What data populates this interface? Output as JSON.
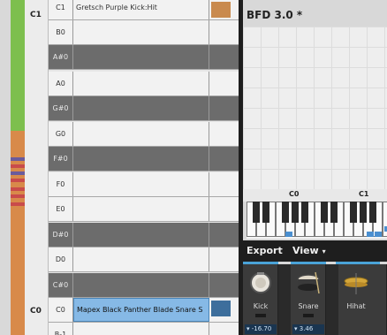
{
  "octave_labels": {
    "c1": "C1",
    "c0": "C0"
  },
  "rows": [
    {
      "note": "C1",
      "type": "white",
      "instrument": "Gretsch Purple Kick:Hit",
      "swatch": "#c98a4e",
      "selected": false
    },
    {
      "note": "B0",
      "type": "white",
      "instrument": "",
      "swatch": null,
      "selected": false
    },
    {
      "note": "A#0",
      "type": "black",
      "instrument": "",
      "swatch": null,
      "selected": false
    },
    {
      "note": "A0",
      "type": "white",
      "instrument": "",
      "swatch": null,
      "selected": false
    },
    {
      "note": "G#0",
      "type": "black",
      "instrument": "",
      "swatch": null,
      "selected": false
    },
    {
      "note": "G0",
      "type": "white",
      "instrument": "",
      "swatch": null,
      "selected": false
    },
    {
      "note": "F#0",
      "type": "black",
      "instrument": "",
      "swatch": null,
      "selected": false
    },
    {
      "note": "F0",
      "type": "white",
      "instrument": "",
      "swatch": null,
      "selected": false
    },
    {
      "note": "E0",
      "type": "white",
      "instrument": "",
      "swatch": null,
      "selected": false
    },
    {
      "note": "D#0",
      "type": "black",
      "instrument": "",
      "swatch": null,
      "selected": false
    },
    {
      "note": "D0",
      "type": "white",
      "instrument": "",
      "swatch": null,
      "selected": false
    },
    {
      "note": "C#0",
      "type": "black",
      "instrument": "",
      "swatch": null,
      "selected": false
    },
    {
      "note": "C0",
      "type": "white",
      "instrument": "Mapex Black Panther Blade Snare S",
      "swatch": "#3d6e9c",
      "selected": true
    },
    {
      "note": "B-1",
      "type": "white",
      "instrument": "",
      "swatch": null,
      "selected": false
    }
  ],
  "right_panel": {
    "title": "BFD 3.0 *",
    "keyboard_labels": [
      "C0",
      "C1"
    ],
    "toolbar": {
      "export": "Export",
      "view": "View",
      "view_arrow": "▾"
    },
    "drums": [
      {
        "name": "Kick",
        "value": "-16.70",
        "value_arrow": "▾"
      },
      {
        "name": "Snare",
        "value": "3.46",
        "value_arrow": "▾"
      },
      {
        "name": "Hihat",
        "value": "",
        "value_arrow": ""
      }
    ]
  },
  "colors": {
    "lane_green": "#7dbf4e",
    "lane_orange": "#d88a4a",
    "lane_purple": "#6b5b9c",
    "lane_red": "#c94b4b",
    "accent_blue": "#4aa3d8"
  }
}
